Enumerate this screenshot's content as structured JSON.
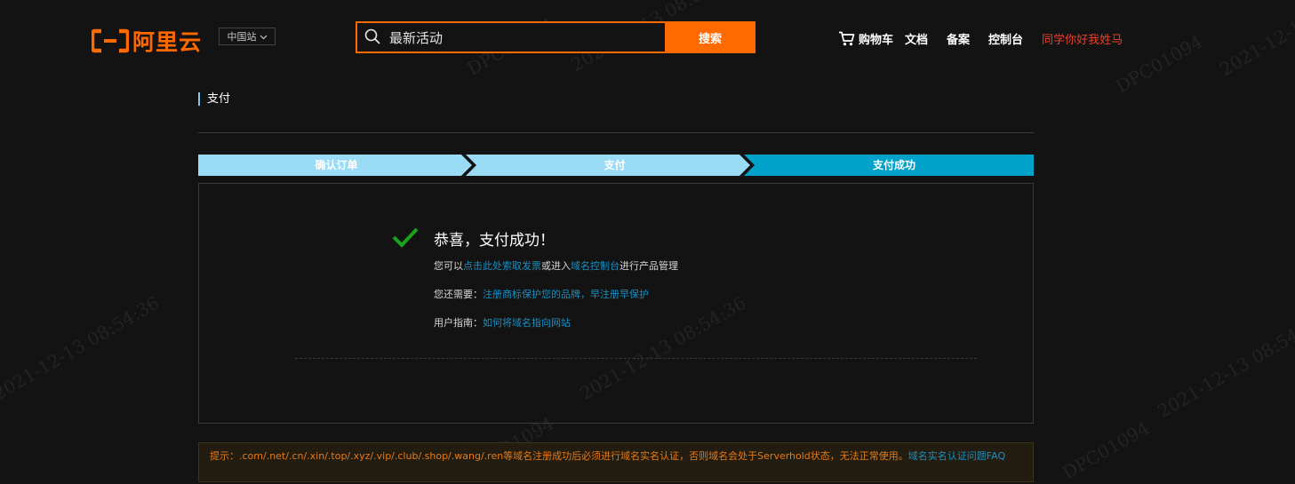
{
  "header": {
    "logo_text": "阿里云",
    "region": "中国站",
    "search_value": "最新活动",
    "search_button": "搜索",
    "nav": {
      "cart": "购物车",
      "docs": "文档",
      "beian": "备案",
      "console": "控制台",
      "user": "同学你好我姓马"
    }
  },
  "page": {
    "title": "支付",
    "steps": [
      {
        "label": "确认订单",
        "state": "done"
      },
      {
        "label": "支付",
        "state": "done"
      },
      {
        "label": "支付成功",
        "state": "current"
      }
    ],
    "success": {
      "title": "恭喜，支付成功！",
      "line1": {
        "prefix": "您可以",
        "link1": "点击此处索取发票",
        "middle": "或进入",
        "link2": "域名控制台",
        "suffix": "进行产品管理"
      },
      "line2": {
        "prefix": "您还需要：",
        "link": "注册商标保护您的品牌，早注册早保护"
      },
      "line3": {
        "prefix": "用户指南：",
        "link": "如何将域名指向网站"
      }
    },
    "tip": {
      "text": "提示：.com/.net/.cn/.xin/.top/.xyz/.vip/.club/.shop/.wang/.ren等域名注册成功后必须进行域名实名认证，否则域名会处于Serverhold状态，无法正常使用。",
      "link": "域名实名认证问题FAQ"
    }
  },
  "watermark": {
    "id": "DPC01094",
    "timestamp": "2021-12-13 08:54:36"
  },
  "colors": {
    "brand_orange": "#ff6a00",
    "step_done": "#9adcf5",
    "step_current": "#00a2ca",
    "link": "#1b8fc1",
    "success_green": "#1aa31a",
    "user_red": "#e8402a"
  }
}
